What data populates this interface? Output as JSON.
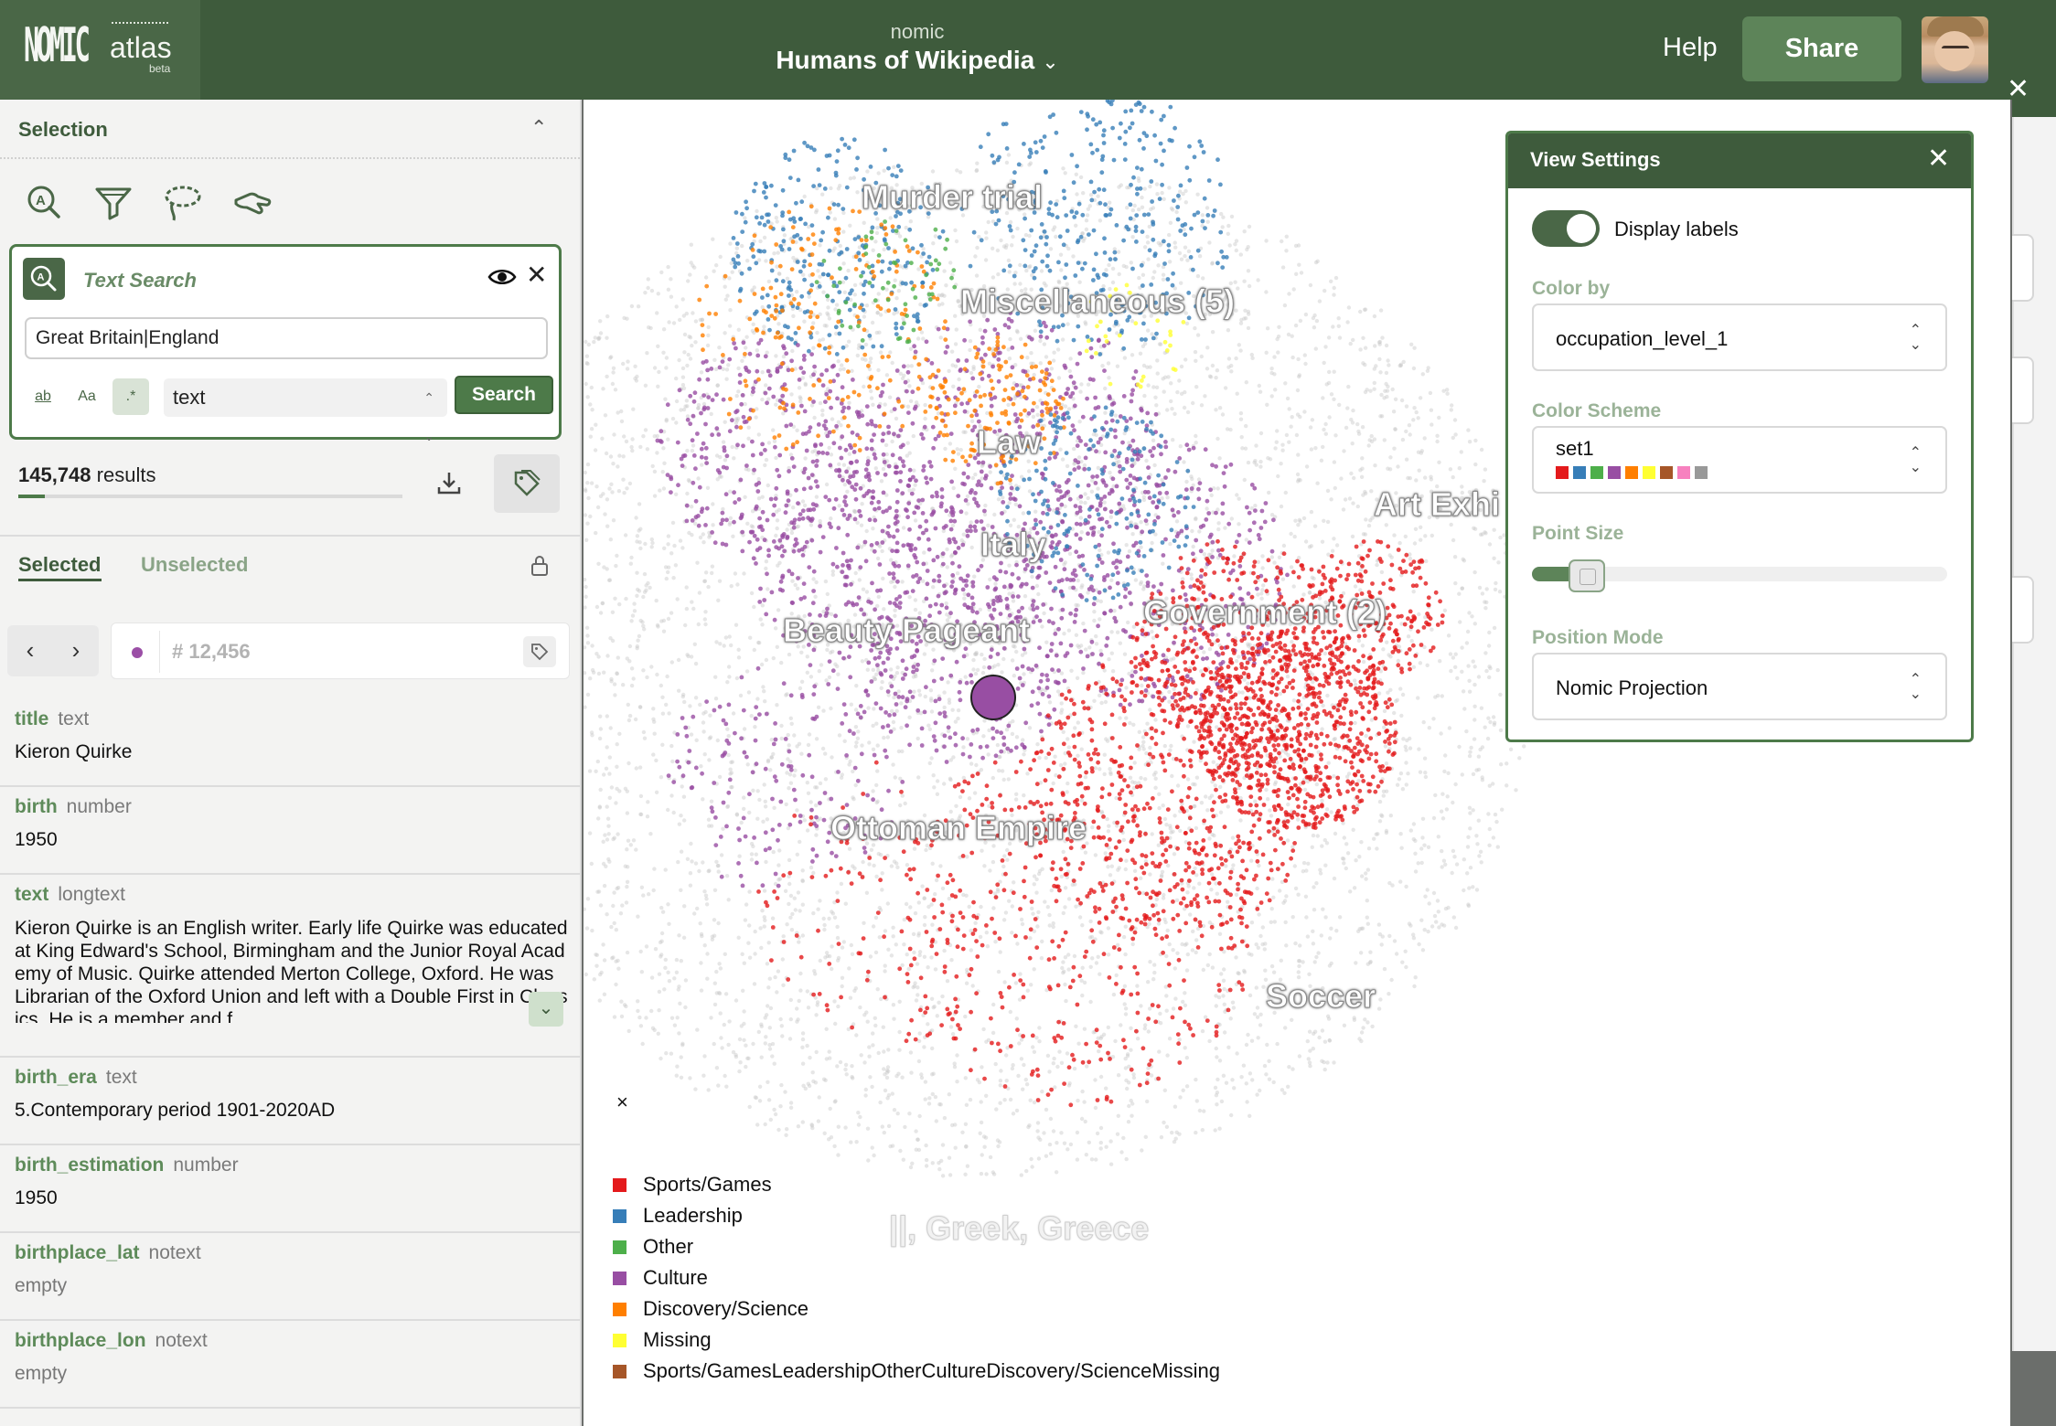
{
  "header": {
    "logo_text": "NOMIC",
    "logo_product": "atlas",
    "logo_badge": "beta",
    "org": "nomic",
    "project": "Humans of Wikipedia",
    "help": "Help",
    "share": "Share"
  },
  "selection": {
    "title": "Selection",
    "tools": [
      "text-search-tool-icon",
      "filter-icon",
      "lasso-icon",
      "hand-pointer-icon"
    ],
    "search": {
      "label": "Text Search",
      "query": "Great Britain|England",
      "option_word": "ab",
      "option_case": "Aa",
      "option_regex": ".*",
      "field": "text",
      "button": "Search"
    },
    "results_count": "145,748",
    "results_suffix": "results",
    "results_progress": 0.07,
    "tabs": {
      "selected": "Selected",
      "unselected": "Unselected"
    },
    "record_id": "# 12,456"
  },
  "record": [
    {
      "name": "title",
      "type": "text",
      "value": "Kieron Quirke"
    },
    {
      "name": "birth",
      "type": "number",
      "value": "1950"
    },
    {
      "name": "text",
      "type": "longtext",
      "value": "Kieron Quirke is an English writer. Early life Quirke was educated at King Edward's School, Birmingham and the Junior Royal Academy of Music. Quirke attended Merton College, Oxford. He was Librarian of the Oxford Union and left with a Double First in Classics. He is a member and f"
    },
    {
      "name": "birth_era",
      "type": "text",
      "value": "5.Contemporary period 1901-2020AD"
    },
    {
      "name": "birth_estimation",
      "type": "number",
      "value": "1950"
    },
    {
      "name": "birthplace_lat",
      "type": "notext",
      "value": "empty"
    },
    {
      "name": "birthplace_lon",
      "type": "notext",
      "value": "empty"
    }
  ],
  "map": {
    "labels": [
      "Murder trial",
      "Miscellaneous (5)",
      "Law",
      "Italy",
      "Beauty Pageant",
      "Government (2)",
      "Art Exhi",
      "Ottoman Empire",
      "Soccer",
      "||, Greek, Greece"
    ],
    "legend_close": "×",
    "legend": [
      {
        "label": "Sports/Games",
        "color": "#e41a1c"
      },
      {
        "label": "Leadership",
        "color": "#377eb8"
      },
      {
        "label": "Other",
        "color": "#4daf4a"
      },
      {
        "label": "Culture",
        "color": "#984ea3"
      },
      {
        "label": "Discovery/Science",
        "color": "#ff7f00"
      },
      {
        "label": "Missing",
        "color": "#ffff33"
      },
      {
        "label": "Sports/GamesLeadershipOtherCultureDiscovery/ScienceMissing",
        "color": "#a65628"
      }
    ],
    "highlight_color": "#984ea3"
  },
  "view_settings": {
    "title": "View Settings",
    "display_labels": "Display labels",
    "display_labels_on": true,
    "color_by_label": "Color by",
    "color_by": "occupation_level_1",
    "color_scheme_label": "Color Scheme",
    "color_scheme": "set1",
    "scheme_colors": [
      "#e41a1c",
      "#377eb8",
      "#4daf4a",
      "#984ea3",
      "#ff7f00",
      "#ffff33",
      "#a65628",
      "#f781bf",
      "#999999"
    ],
    "point_size_label": "Point Size",
    "point_size_level": 0.09,
    "position_mode_label": "Position Mode",
    "position_mode": "Nomic Projection"
  },
  "colors": {
    "brand_dark": "#3e5b3c",
    "brand": "#4d7a49",
    "accent_text": "#5e8b5a"
  }
}
